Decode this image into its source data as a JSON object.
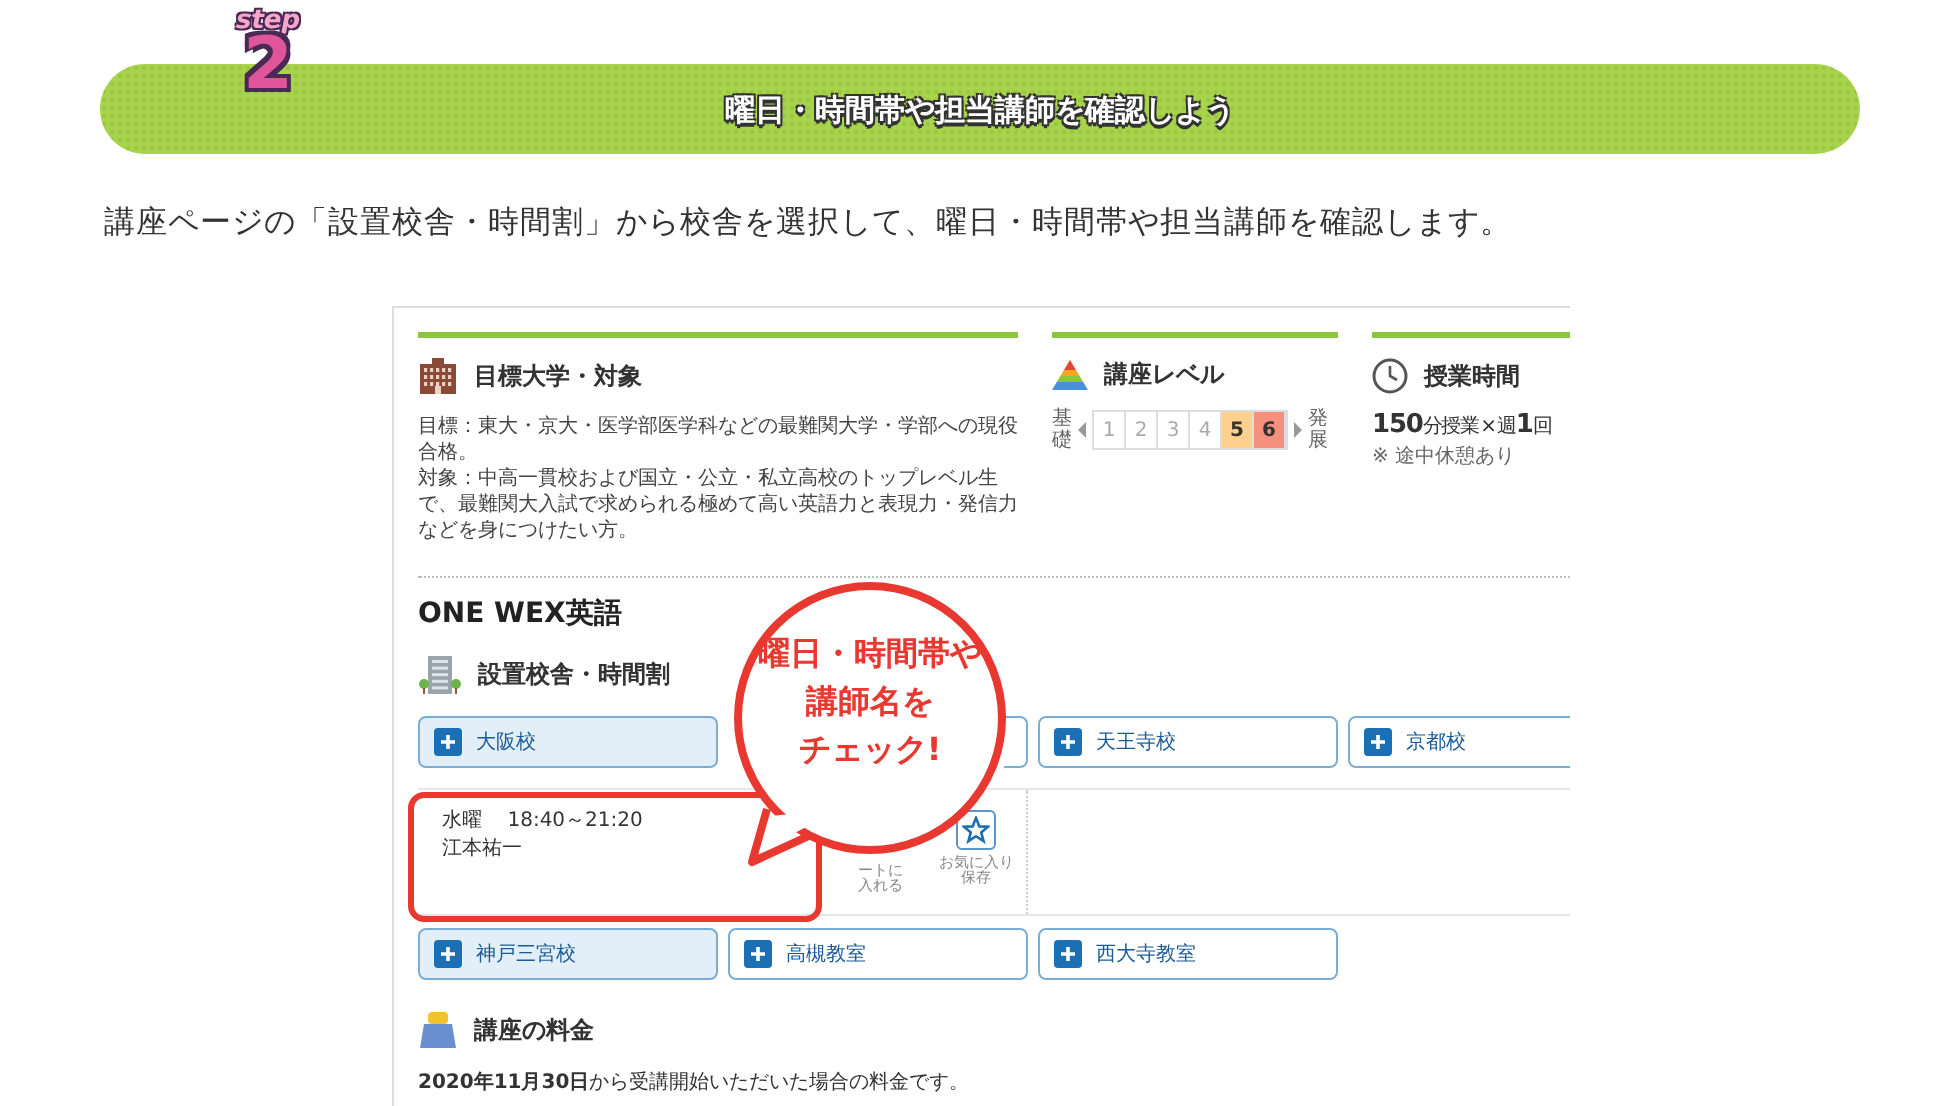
{
  "step": {
    "label": "step",
    "number": "2"
  },
  "banner": {
    "title": "曜日・時間帯や担当講師を確認しよう"
  },
  "instruction": "講座ページの「設置校舎・時間割」から校舎を選択して、曜日・時間帯や担当講師を確認します。",
  "course_page": {
    "target": {
      "heading": "目標大学・対象",
      "paragraphs": [
        "目標：東大・京大・医学部医学科などの最難関大学・学部への現役合格。",
        "対象：中高一貫校および国立・公立・私立高校のトップレベル生で、最難関大入試で求められる極めて高い英語力と表現力・発信力などを身につけたい方。"
      ]
    },
    "level": {
      "heading": "講座レベル",
      "low": "基礎",
      "high": "発展",
      "steps": [
        {
          "label": "1",
          "color": "#ffffff"
        },
        {
          "label": "2",
          "color": "#ffffff"
        },
        {
          "label": "3",
          "color": "#ffffff"
        },
        {
          "label": "4",
          "color": "#ffffff"
        },
        {
          "label": "5",
          "color": "#fdd08e"
        },
        {
          "label": "6",
          "color": "#f6907c"
        }
      ]
    },
    "duration": {
      "heading": "授業時間",
      "text": "**150**分授業 × 週**1**回",
      "note": "※ 途中休憩あり"
    },
    "course_title": "ONE WEX英語",
    "schedule": {
      "heading": "設置校舎・時間割",
      "campuses_row_1": [
        {
          "label": "大阪校",
          "selected": true
        },
        {
          "selected": false
        },
        {
          "label": "天王寺校",
          "selected": false
        },
        {
          "label": "京都校",
          "selected": false
        }
      ],
      "detail": {
        "day": "水曜",
        "time": "18:40～21:20",
        "teacher": "江本祐一",
        "cart_label": [
          "ートに",
          "入れる"
        ],
        "favorite_label": [
          "お気に入り",
          "保存"
        ]
      },
      "campuses_row_2": [
        {
          "label": "神戸三宮校",
          "selected": true
        },
        {
          "label": "高槻教室",
          "selected": false
        },
        {
          "label": "西大寺教室",
          "selected": false
        }
      ]
    },
    "fee": {
      "heading": "講座の料金",
      "text": "**2020年11月30日**から受講開始いただいた場合の料金です。"
    }
  },
  "callout": {
    "lines": [
      "曜日・時間帯や",
      "講師名を",
      "チェック!"
    ]
  }
}
